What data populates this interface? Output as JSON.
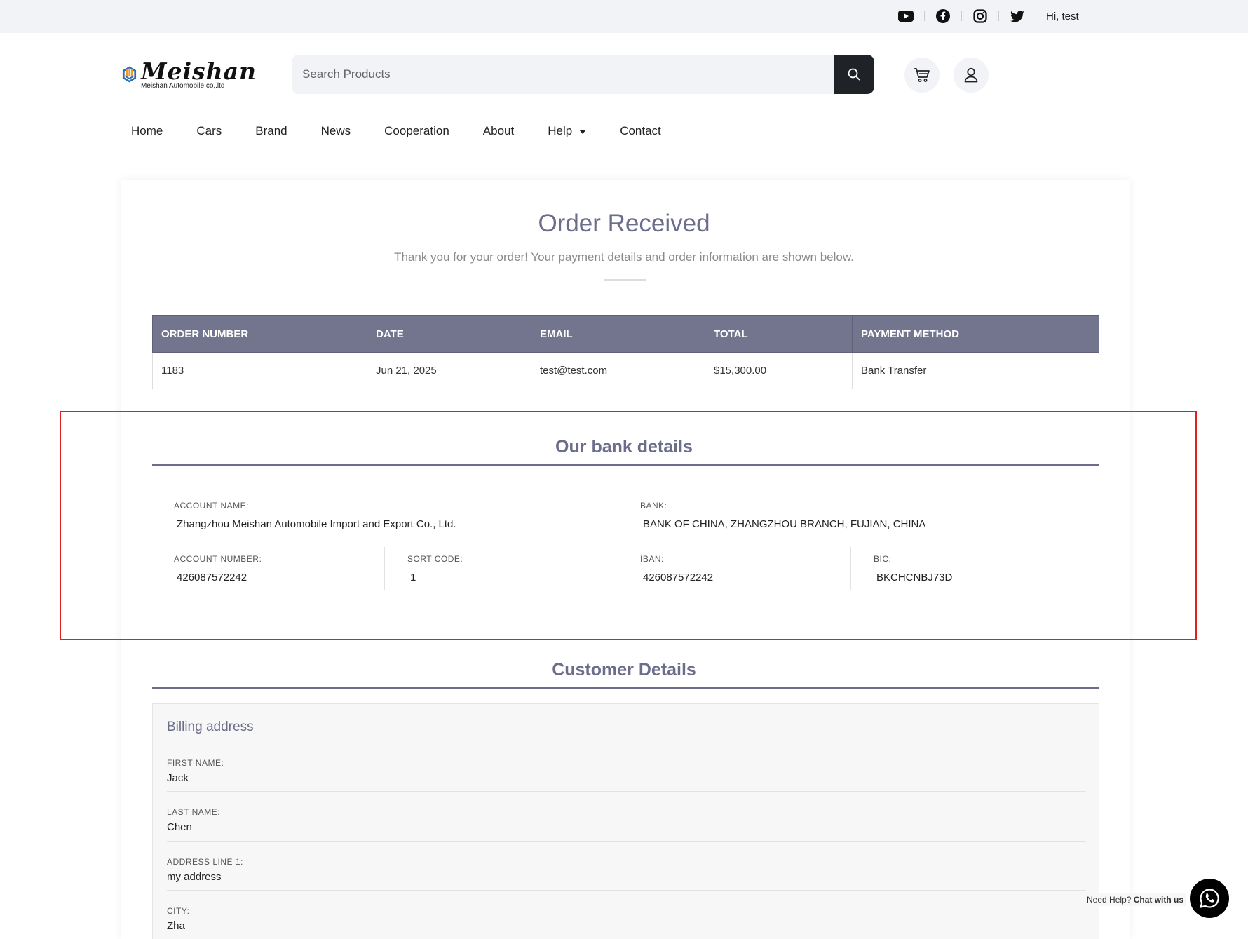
{
  "topbar": {
    "social_icons": [
      "youtube-icon",
      "facebook-icon",
      "instagram-icon",
      "twitter-icon"
    ],
    "greeting": "Hi, test"
  },
  "logo": {
    "title": "Meishan",
    "subtitle": "Meishan Automobile co,.ltd"
  },
  "search": {
    "placeholder": "Search Products"
  },
  "nav": {
    "items": [
      "Home",
      "Cars",
      "Brand",
      "News",
      "Cooperation",
      "About",
      "Help",
      "Contact"
    ]
  },
  "order": {
    "title": "Order Received",
    "subtitle": "Thank you for your order! Your payment details and order information are shown below.",
    "table": {
      "headers": [
        "ORDER NUMBER",
        "DATE",
        "EMAIL",
        "TOTAL",
        "PAYMENT METHOD"
      ],
      "row": [
        "1183",
        "Jun 21, 2025",
        "test@test.com",
        "$15,300.00",
        "Bank Transfer"
      ]
    }
  },
  "bank": {
    "title": "Our bank details",
    "account_name_label": "ACCOUNT NAME:",
    "account_name": "Zhangzhou Meishan Automobile Import and Export Co., Ltd.",
    "bank_label": "BANK:",
    "bank": "BANK OF CHINA, ZHANGZHOU BRANCH, FUJIAN, CHINA",
    "account_number_label": "ACCOUNT NUMBER:",
    "account_number": "426087572242",
    "sort_code_label": "SORT CODE:",
    "sort_code": "1",
    "iban_label": "IBAN:",
    "iban": "426087572242",
    "bic_label": "BIC:",
    "bic": "BKCHCNBJ73D"
  },
  "customer": {
    "title": "Customer Details",
    "billing_title": "Billing address",
    "fields": [
      {
        "label": "FIRST NAME:",
        "value": "Jack"
      },
      {
        "label": "LAST NAME:",
        "value": "Chen"
      },
      {
        "label": "ADDRESS LINE 1:",
        "value": "my address"
      },
      {
        "label": "CITY:",
        "value": "Zha"
      }
    ]
  },
  "chat": {
    "need_help": "Need Help?",
    "chat_label": "Chat with us"
  },
  "colors": {
    "accent": "#6b6d8a",
    "table_header": "#73758f",
    "highlight_border": "#e02020"
  }
}
